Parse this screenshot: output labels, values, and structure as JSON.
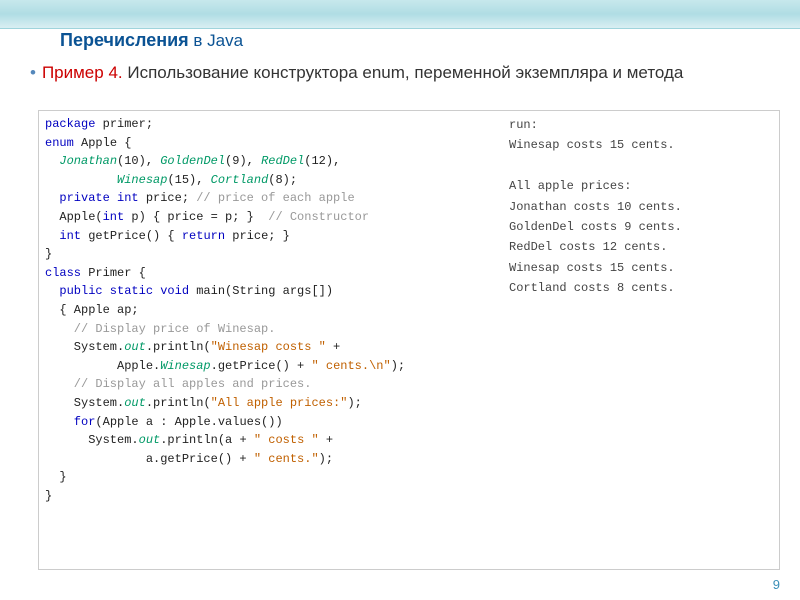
{
  "title": {
    "main": "Перечисления",
    "in": " в ",
    "java": "Java"
  },
  "bullet": {
    "label": "Пример 4.",
    "rest": " Использование конструктора enum, переменной экземпляра и метода"
  },
  "code": {
    "l01a": "package",
    "l01b": " primer;",
    "l02a": "enum",
    "l02b": " Apple {",
    "l03a": "  ",
    "l03j": "Jonathan",
    "l03b": "(10), ",
    "l03g": "GoldenDel",
    "l03c": "(9), ",
    "l03r": "RedDel",
    "l03d": "(12),",
    "l04a": "          ",
    "l04w": "Winesap",
    "l04b": "(15), ",
    "l04c": "Cortland",
    "l04d": "(8);",
    "l05a": "  private int",
    "l05b": " price; ",
    "l05c": "// price of each apple",
    "l06a": "  Apple(",
    "l06b": "int",
    "l06c": " p) { price = p; }  ",
    "l06d": "// Constructor",
    "l07a": "  int",
    "l07b": " getPrice() { ",
    "l07c": "return",
    "l07d": " price; }",
    "l08": "}",
    "l09a": "class",
    "l09b": " Primer {",
    "l10a": "  public static void",
    "l10b": " main(String args[])",
    "l11": "  { Apple ap;",
    "l12": "    // Display price of Winesap.",
    "l13a": "    System.",
    "l13o": "out",
    "l13b": ".println(",
    "l13s": "\"Winesap costs \"",
    "l13c": " +",
    "l14a": "          Apple.",
    "l14w": "Winesap",
    "l14b": ".getPrice() + ",
    "l14s": "\" cents.\\n\"",
    "l14c": ");",
    "l15": "    // Display all apples and prices.",
    "l16a": "    System.",
    "l16o": "out",
    "l16b": ".println(",
    "l16s": "\"All apple prices:\"",
    "l16c": ");",
    "l17a": "    for",
    "l17b": "(Apple a : Apple.values())",
    "l18a": "      System.",
    "l18o": "out",
    "l18b": ".println(a + ",
    "l18s": "\" costs \"",
    "l18c": " +",
    "l19a": "              a.getPrice() + ",
    "l19s": "\" cents.\"",
    "l19b": ");",
    "l20": "  }",
    "l21": "}"
  },
  "output": {
    "l1": "run:",
    "l2": "Winesap costs 15 cents.",
    "l3": "",
    "l4": "All apple prices:",
    "l5": "Jonathan costs 10 cents.",
    "l6": "GoldenDel costs 9 cents.",
    "l7": "RedDel costs 12 cents.",
    "l8": "Winesap costs 15 cents.",
    "l9": "Cortland costs 8 cents."
  },
  "slidenum": "9"
}
